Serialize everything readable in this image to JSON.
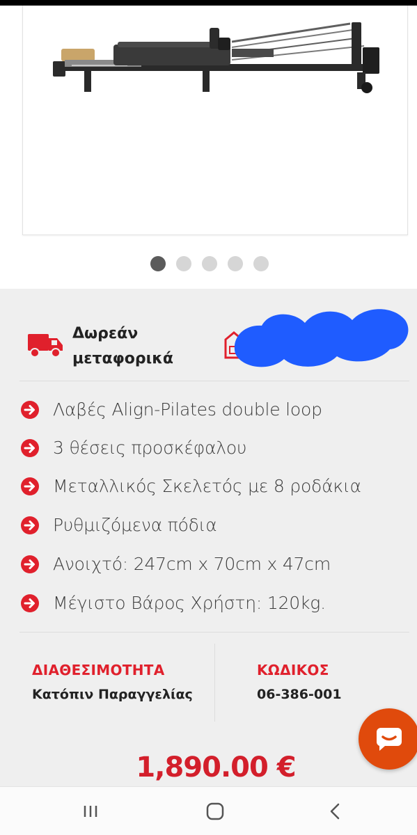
{
  "carousel": {
    "total": 5,
    "active_index": 0
  },
  "shipping": {
    "line1": "Δωρεάν",
    "line2": "μεταφορικά",
    "icon": "truck-icon"
  },
  "features": [
    {
      "text": "Λαβές Align-Pilates double loop",
      "icon": "arrow-right-circle-icon"
    },
    {
      "text": "3 θέσεις προσκέφαλου",
      "icon": "arrow-right-circle-icon"
    },
    {
      "text": "Μεταλλικός Σκελετός με 8 ροδάκια",
      "icon": "arrow-right-circle-icon"
    },
    {
      "text": "Ρυθμιζόμενα πόδια",
      "icon": "arrow-right-circle-icon"
    },
    {
      "text": "Ανοιχτό: 247cm x 70cm x 47cm",
      "icon": "arrow-right-circle-icon"
    },
    {
      "text": "Μέγιστο Βάρος Χρήστη: 120kg.",
      "icon": "arrow-right-circle-icon"
    }
  ],
  "availability": {
    "label": "ΔΙΑΘΕΣΙΜΟΤΗΤΑ",
    "value": "Κατόπιν Παραγγελίας"
  },
  "code": {
    "label": "ΚΩΔΙΚΟΣ",
    "value": "06-386-001"
  },
  "price": "1,890.00 €",
  "colors": {
    "accent_red": "#e0202c",
    "price_red": "#d31f2b",
    "chat_orange": "#e04a0c",
    "redaction_blue": "#1f5cff"
  },
  "navbar": {
    "icons": [
      "recent-apps-icon",
      "home-icon",
      "back-icon"
    ]
  }
}
